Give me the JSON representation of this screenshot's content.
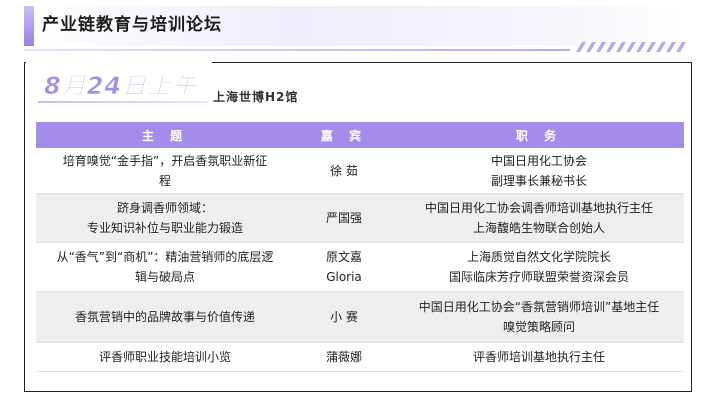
{
  "header": {
    "title": "产业链教育与培训论坛"
  },
  "session": {
    "date_time": "8月24日上午",
    "venue": "上海世博H2馆"
  },
  "table": {
    "columns": [
      "主 题",
      "嘉 宾",
      "职 务"
    ],
    "rows": [
      {
        "topic": "培育嗅觉“金手指”，开启香氛职业新征\n程",
        "speaker": "徐  茹",
        "role": "中国日用化工协会\n副理事长兼秘书长"
      },
      {
        "topic": "跻身调香师领域：\n专业知识补位与职业能力锻造",
        "speaker": "严国强",
        "role": "中国日用化工协会调香师培训基地执行主任\n上海馥皓生物联合创始人"
      },
      {
        "topic": "从“香气”到“商机”：精油营销师的底层逻\n辑与破局点",
        "speaker": "原文嘉\nGloria",
        "role": "上海质觉自然文化学院院长\n国际临床芳疗师联盟荣誉资深会员"
      },
      {
        "topic": "香氛营销中的品牌故事与价值传递",
        "speaker": "小  赛",
        "role": "中国日用化工协会“香氛营销师培训”基地主任\n嗅觉策略顾问"
      },
      {
        "topic": "评香师职业技能培训小览",
        "speaker": "蒲薇娜",
        "role": "评香师培训基地执行主任"
      }
    ]
  },
  "colors": {
    "accent": "#a48cea",
    "row_alt": "#eeeeee"
  }
}
